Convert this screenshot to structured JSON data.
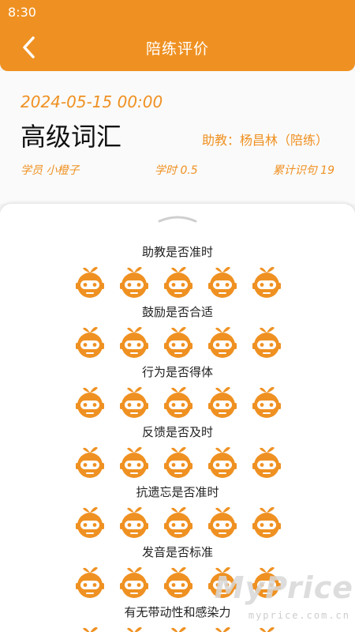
{
  "status_bar": {
    "time": "8:30"
  },
  "header": {
    "title": "陪练评价",
    "back_icon": "chevron-left-icon"
  },
  "lesson": {
    "datetime": "2024-05-15 00:00",
    "course": "高级词汇",
    "teacher": "助教：杨昌林（陪练）",
    "student": "学员 小橙子",
    "hours": "学时 0.5",
    "sentences": "累计识句 19"
  },
  "rating_icon": "orange-robot-icon",
  "criteria": [
    {
      "label": "助教是否准时",
      "rating": 5
    },
    {
      "label": "鼓励是否合适",
      "rating": 5
    },
    {
      "label": "行为是否得体",
      "rating": 5
    },
    {
      "label": "反馈是否及时",
      "rating": 5
    },
    {
      "label": "抗遗忘是否准时",
      "rating": 5
    },
    {
      "label": "发音是否标准",
      "rating": 5
    },
    {
      "label": "有无带动性和感染力",
      "rating": 5
    }
  ],
  "watermark": {
    "brand": "MyPrice",
    "site": "myprice.com.cn"
  },
  "colors": {
    "accent": "#ef9122",
    "text_dark": "#222222",
    "background": "#f5f5f5"
  }
}
